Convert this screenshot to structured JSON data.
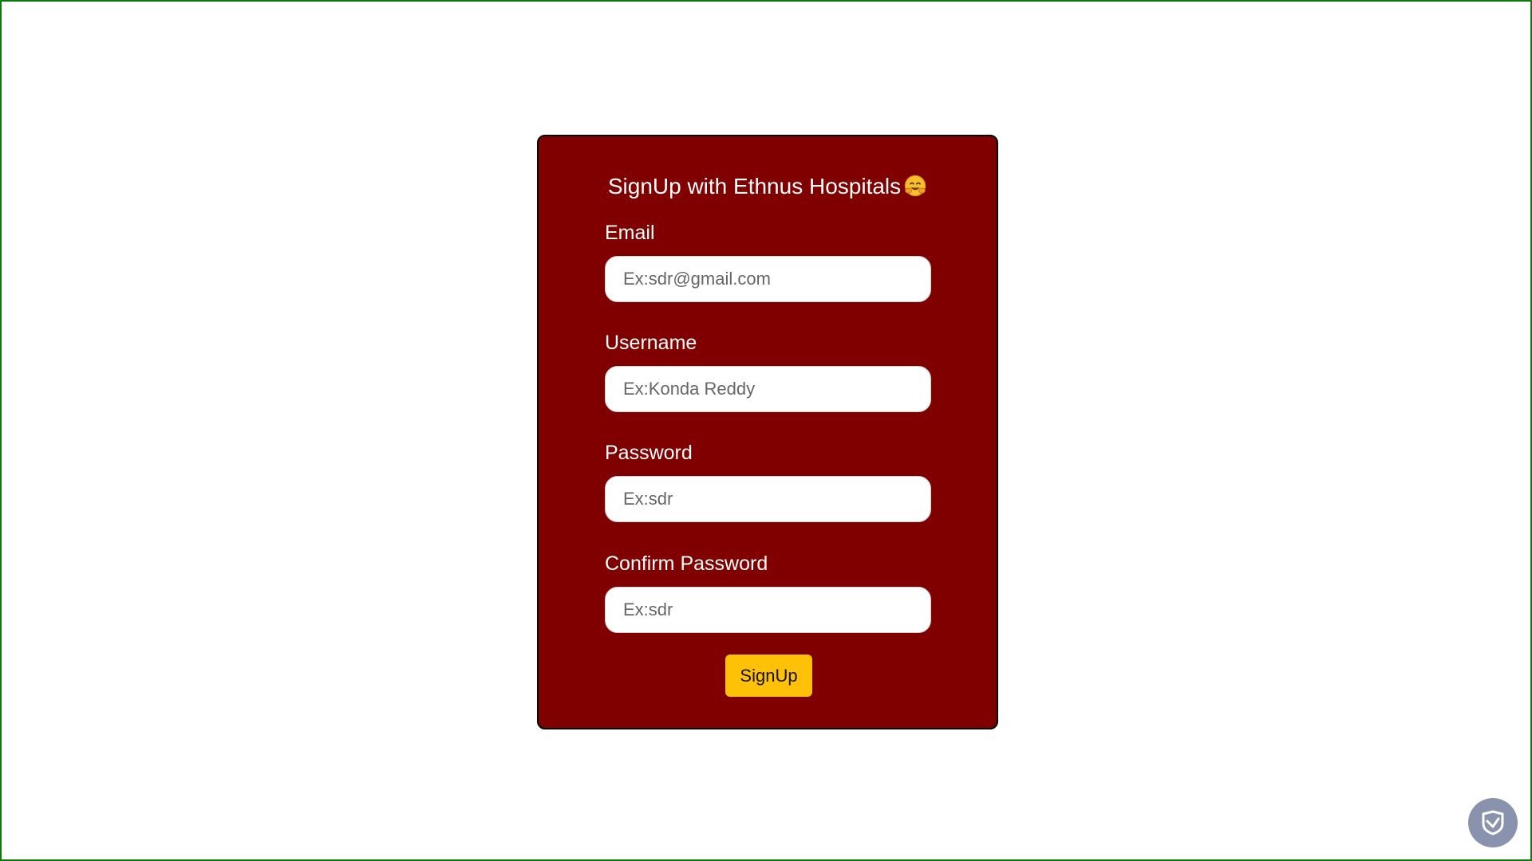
{
  "form": {
    "title": "SignUp with Ethnus Hospitals",
    "title_emoji": "hugging-face-emoji",
    "email": {
      "label": "Email",
      "placeholder": "Ex:sdr@gmail.com",
      "value": ""
    },
    "username": {
      "label": "Username",
      "placeholder": "Ex:Konda Reddy",
      "value": ""
    },
    "password": {
      "label": "Password",
      "placeholder": "Ex:sdr",
      "value": ""
    },
    "confirm_password": {
      "label": "Confirm Password",
      "placeholder": "Ex:sdr",
      "value": ""
    },
    "submit_label": "SignUp"
  },
  "floating_badge": {
    "icon": "shield-check-icon"
  },
  "colors": {
    "page_border": "#0b7a0b",
    "card_background": "#800000",
    "button_background": "#ffc107",
    "badge_background": "#8a93ad"
  }
}
